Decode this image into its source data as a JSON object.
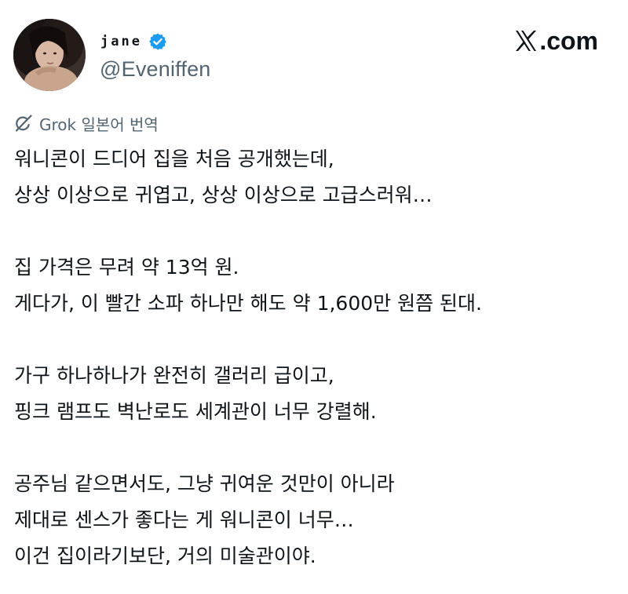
{
  "author": {
    "display_name": "jane",
    "handle": "@Eveniffen",
    "verified": true,
    "verified_color": "#1d9bf0"
  },
  "brand": {
    "label": ".com",
    "icon": "x-logo-icon"
  },
  "translation": {
    "label": "Grok 일본어 번역",
    "icon": "grok-icon"
  },
  "tweet": {
    "paragraphs": [
      [
        "워니콘이 드디어 집을 처음 공개했는데,",
        "상상 이상으로 귀엽고, 상상 이상으로 고급스러워…"
      ],
      [
        "집 가격은 무려 약 13억 원.",
        "게다가, 이 빨간 소파 하나만 해도 약 1,600만 원쯤 된대."
      ],
      [
        "가구 하나하나가 완전히 갤러리 급이고,",
        "핑크 램프도 벽난로도 세계관이 너무 강렬해."
      ],
      [
        "공주님 같으면서도, 그냥 귀여운 것만이 아니라",
        "제대로 센스가 좋다는 게 워니콘이 너무…",
        "이건 집이라기보단, 거의 미술관이야."
      ]
    ]
  }
}
